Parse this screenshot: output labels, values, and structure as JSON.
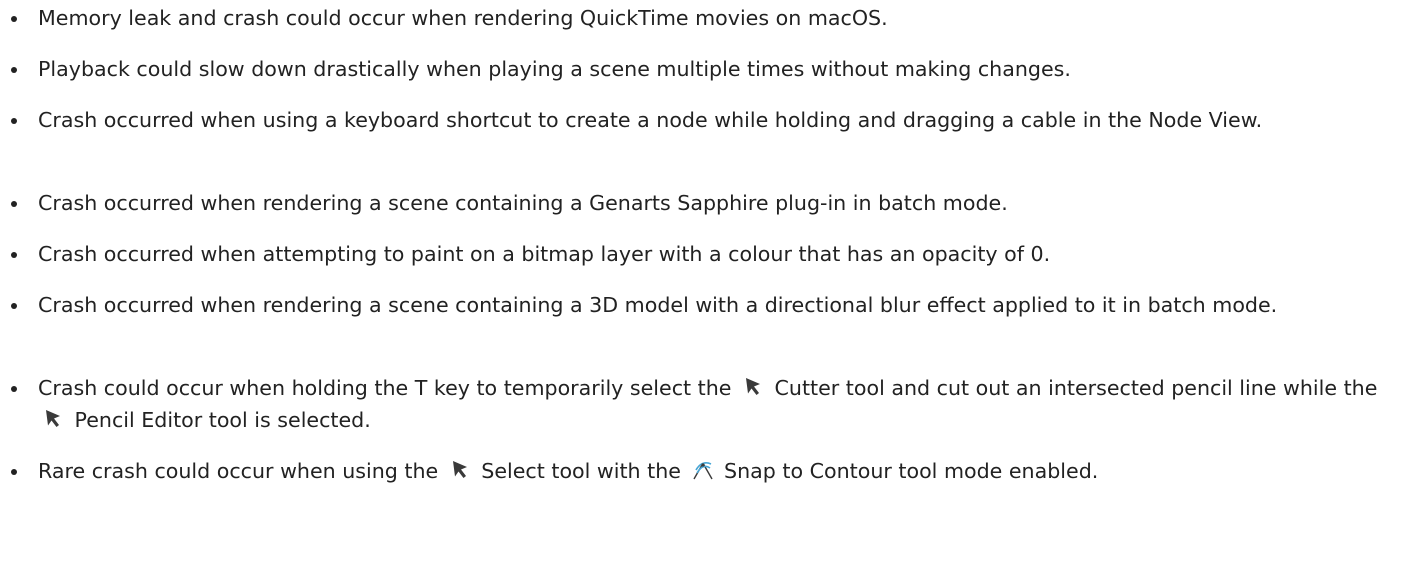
{
  "notes": [
    {
      "text": "Memory leak and crash could occur when rendering QuickTime movies on macOS."
    },
    {
      "text": "Playback could slow down drastically when playing a scene multiple times without making changes."
    },
    {
      "text": "Crash occurred when using a keyboard shortcut to create a node while holding and dragging a cable in the Node View."
    },
    {
      "text": "Crash occurred when rendering a scene containing a Genarts Sapphire plug-in in batch mode."
    },
    {
      "text": "Crash occurred when attempting to paint on a bitmap layer with a colour that has an opacity of 0."
    },
    {
      "text": "Crash occurred when rendering a scene containing a 3D model with a directional blur effect applied to it in batch mode."
    },
    {
      "part1": "Crash could occur when holding the T key to temporarily select the",
      "part2": "Cutter tool and cut out an intersected pencil line while the",
      "part3": "Pencil Editor tool is selected.",
      "icons": [
        "arrow-cursor-icon",
        "arrow-cursor-icon"
      ]
    },
    {
      "part1": "Rare crash could occur when using the",
      "part2": "Select tool with the",
      "part3": "Snap to Contour tool mode enabled.",
      "icons": [
        "arrow-cursor-icon",
        "snap-to-contour-icon"
      ]
    }
  ]
}
